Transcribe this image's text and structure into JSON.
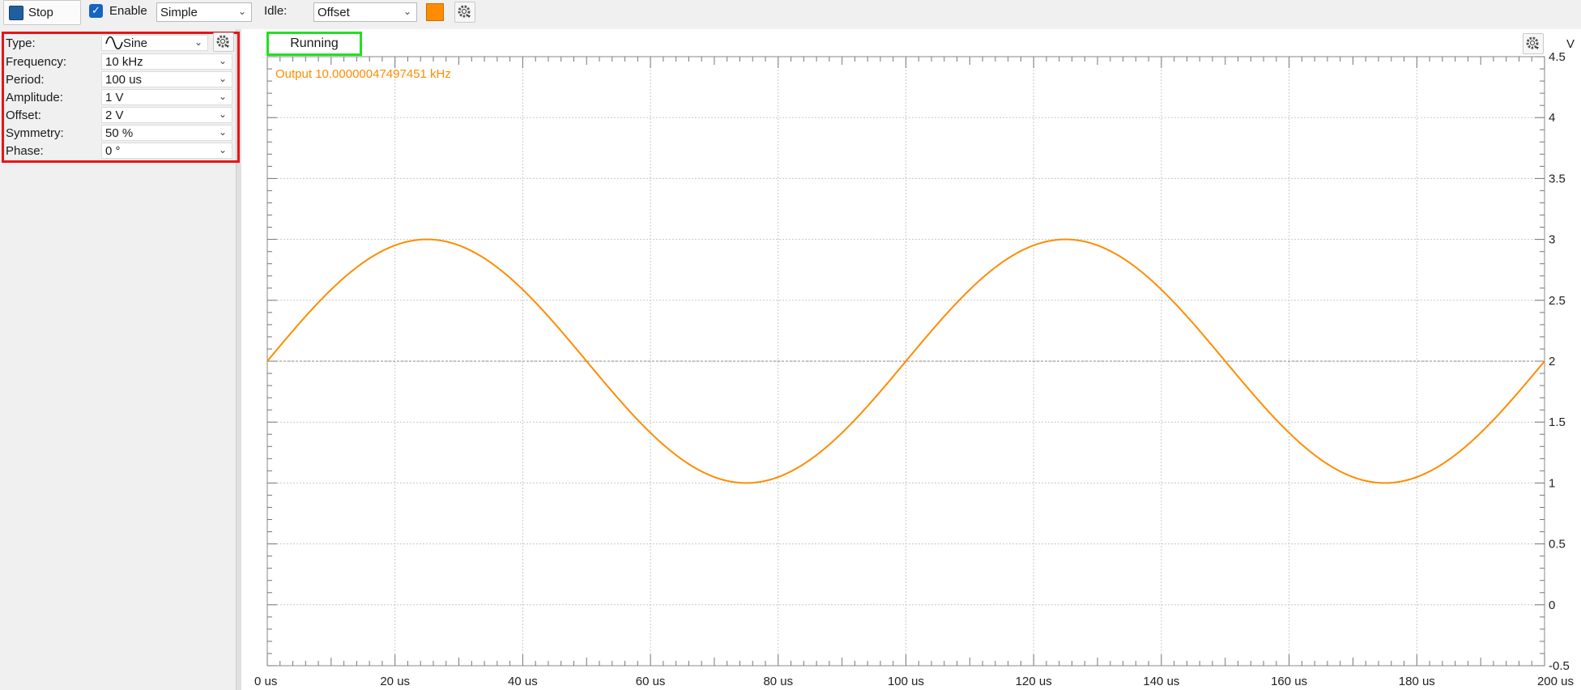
{
  "toolbar": {
    "stop_label": "Stop",
    "enable_label": "Enable",
    "enable_checked": true,
    "mode_value": "Simple",
    "idle_label": "Idle:",
    "idle_value": "Offset",
    "color": "#ff8c00",
    "settings_icon": "gear-icon"
  },
  "settings": [
    {
      "label": "Type:",
      "value": "Sine",
      "icon": "sine-wave-icon"
    },
    {
      "label": "Frequency:",
      "value": "10 kHz"
    },
    {
      "label": "Period:",
      "value": "100 us"
    },
    {
      "label": "Amplitude:",
      "value": "1 V"
    },
    {
      "label": "Offset:",
      "value": "2 V"
    },
    {
      "label": "Symmetry:",
      "value": "50 %"
    },
    {
      "label": "Phase:",
      "value": "0 °"
    }
  ],
  "status": {
    "text": "Running",
    "border_color": "#22e022"
  },
  "highlight": {
    "settings_border_color": "#e81419"
  },
  "chart_data": {
    "type": "line",
    "ylabel": "V",
    "xlim_us": [
      0,
      200
    ],
    "ylim": [
      -0.5,
      4.5
    ],
    "x_ticks": [
      "0 us",
      "20 us",
      "40 us",
      "60 us",
      "80 us",
      "100 us",
      "120 us",
      "140 us",
      "160 us",
      "180 us",
      "200 us"
    ],
    "y_ticks": [
      "4.5",
      "4",
      "3.5",
      "3",
      "2.5",
      "2",
      "1.5",
      "1",
      "0.5",
      "0",
      "-0.5"
    ],
    "grid": true,
    "reference_line_y": 2,
    "series": [
      {
        "name": "Output 10.00000047497451 kHz",
        "color": "#ff8c00",
        "waveform": "sine",
        "frequency_hz": 10000,
        "amplitude_v": 1,
        "offset_v": 2,
        "phase_deg": 0
      }
    ]
  }
}
